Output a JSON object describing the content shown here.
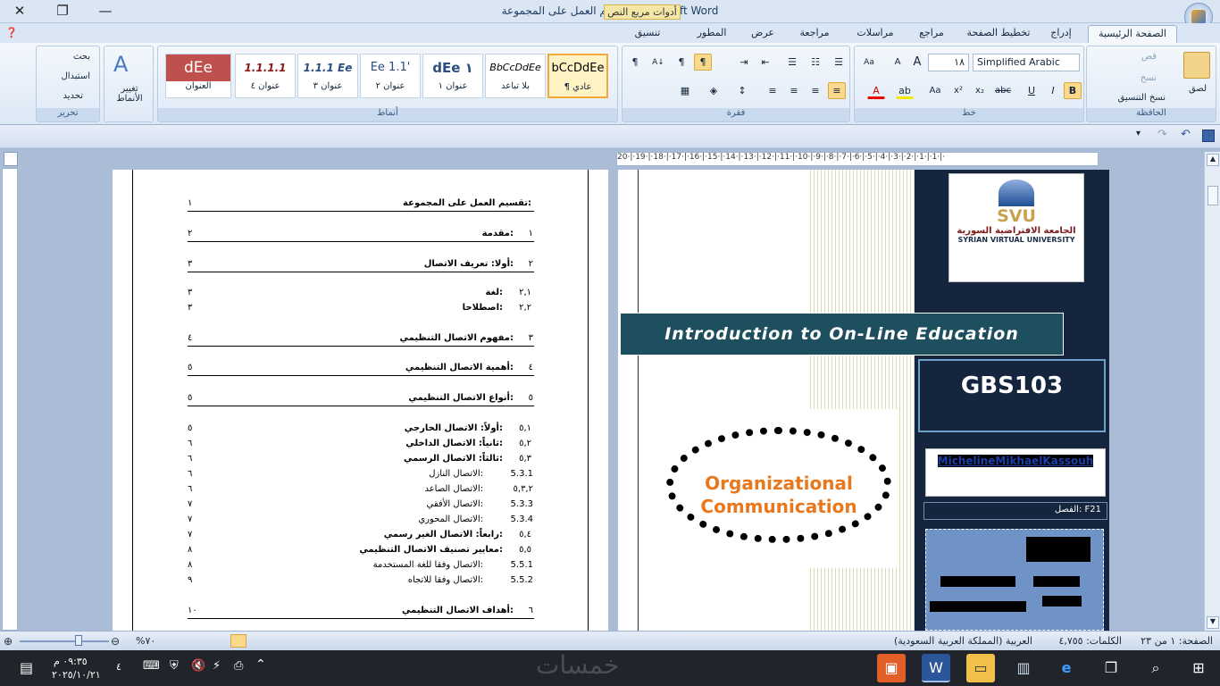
{
  "window": {
    "title": "تقسيم العمل على المجموعة - Microsoft Word",
    "context_tab": "أدوات مربع النص"
  },
  "tabs": [
    "الصفحة الرئيسية",
    "إدراج",
    "تخطيط الصفحة",
    "مراجع",
    "مراسلات",
    "مراجعة",
    "عرض",
    "المطور",
    "تنسيق"
  ],
  "ribbon": {
    "clipboard": {
      "label": "الحافظة",
      "paste": "لصق",
      "cut": "قص",
      "copy": "نسخ",
      "format_painter": "نسخ التنسيق"
    },
    "font": {
      "label": "خط",
      "name": "Simplified Arabic",
      "size": "١٨"
    },
    "paragraph": {
      "label": "فقرة"
    },
    "styles": {
      "label": "أنماط",
      "items": [
        {
          "preview": "bCcDdEe",
          "name": "¶ عادي"
        },
        {
          "preview": "BbCcDdEe",
          "name": "بلا تباعد"
        },
        {
          "preview": "dEe ١",
          "name": "عنوان ١"
        },
        {
          "preview": "Ee 1.1'",
          "name": "عنوان ٢"
        },
        {
          "preview": "1.1.1 Ee",
          "name": "عنوان ٣"
        },
        {
          "preview": "1.1.1.1",
          "name": "عنوان ٤"
        },
        {
          "preview": "dEe",
          "name": "العنوان"
        }
      ],
      "change": "تغيير الأنماط"
    },
    "editing": {
      "label": "تحرير",
      "find": "بحث",
      "replace": "استبدال",
      "select": "تحديد"
    }
  },
  "toc": {
    "title": "تقسيم العمل على المجموعة:",
    "title_page": "١",
    "entries": [
      {
        "num": "١",
        "text": "مقدمة:",
        "page": "٢"
      },
      {
        "num": "٢",
        "text": "أولا: تعريف الاتصال:",
        "page": "٣"
      },
      {
        "num": "٢,١",
        "text": "لغة:",
        "page": "٣"
      },
      {
        "num": "٢,٢",
        "text": "اصطلاحا:",
        "page": "٣"
      },
      {
        "num": "٣",
        "text": "مفهوم الاتصال التنظيمي:",
        "page": "٤"
      },
      {
        "num": "٤",
        "text": "أهمية الاتصال التنظيمي:",
        "page": "٥"
      },
      {
        "num": "٥",
        "text": "أنواع الاتصال التنظيمي:",
        "page": "٥"
      },
      {
        "num": "٥,١",
        "text": "أولاً: الاتصال الخارجي:",
        "page": "٥"
      },
      {
        "num": "٥,٢",
        "text": "ثانياً: الاتصال الداخلي:",
        "page": "٦"
      },
      {
        "num": "٥,٣",
        "text": "ثالثاً: الاتصال الرسمي:",
        "page": "٦"
      },
      {
        "num": "5.3.1",
        "text": "الاتصال النازل:",
        "page": "٦"
      },
      {
        "num": "٥,٣,٢",
        "text": "الاتصال الصاعد:",
        "page": "٦"
      },
      {
        "num": "5.3.3",
        "text": "الاتصال الأفقي:",
        "page": "٧"
      },
      {
        "num": "5.3.4",
        "text": "الاتصال المحوري:",
        "page": "٧"
      },
      {
        "num": "٥,٤",
        "text": "رابعاً: الاتصال الغير رسمي:",
        "page": "٧"
      },
      {
        "num": "٥,٥",
        "text": "معايير تصنيف الاتصال التنظيمي:",
        "page": "٨"
      },
      {
        "num": "5.5.1",
        "text": "الاتصال وفقا للغة المستخدمة:",
        "page": "٨"
      },
      {
        "num": "5.5.2",
        "text": "الاتصال وفقا للاتجاه:",
        "page": "٩"
      },
      {
        "num": "٦",
        "text": "أهداف الاتصال التنظيمي:",
        "page": "١٠"
      }
    ]
  },
  "cover": {
    "logo_abbr": "SVU",
    "logo_ar": "الجامعة الافتراضية السورية",
    "logo_en": "SYRIAN VIRTUAL UNIVERSITY",
    "course_title": "Introduction to On-Line Education",
    "course_code": "GBS103",
    "image_line1": "Organizational",
    "image_line2": "Communication",
    "author": "MichelineMikhaelKassouh",
    "class_label": "الفصل:",
    "class_value": "F21"
  },
  "status": {
    "page": "الصفحة: ١ من ٢٣",
    "words": "الكلمات: ٤,٧٥٥",
    "language": "العربية (المملكة العربية السعودية)",
    "zoom": "%٧٠"
  },
  "taskbar": {
    "time": "٠٩:٣٥ م",
    "date": "٢٠٢٥/١٠/٢١",
    "notif": "٤",
    "watermark": "خمسات"
  },
  "hruler": "20·|·19·|·18·|·17·|·16·|·15·|·14·|·13·|·12·|·11·|·10·|·9·|·8·|·7·|·6·|·5·|·4·|·3·|·2·|·1·|·1·|·"
}
